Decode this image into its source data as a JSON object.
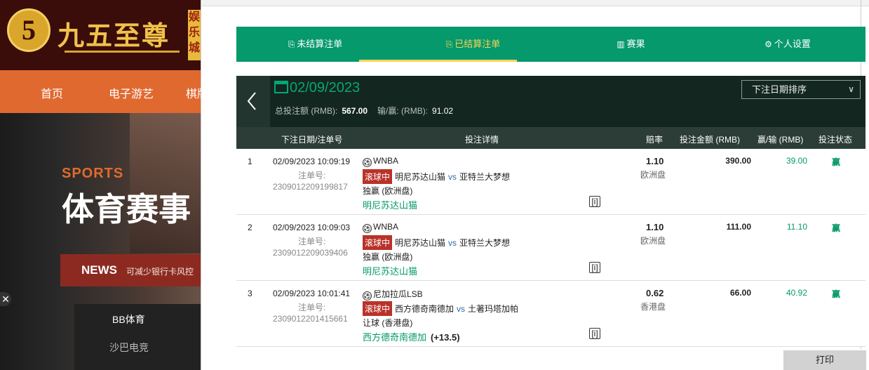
{
  "background_site": {
    "logo_glyph": "5",
    "logo_text": "九五至尊",
    "side_badge": "娱乐城",
    "nav": [
      "首页",
      "电子游艺",
      "棋牌"
    ],
    "sports_label": "SPORTS",
    "hero_title": "体育赛事",
    "news_label": "NEWS",
    "news_text": "可减少银行卡风控",
    "menu": [
      "BB体育",
      "沙巴电竞"
    ],
    "close_glyph": "✕"
  },
  "tabs": [
    {
      "icon": "⎘",
      "label": "未结算注单"
    },
    {
      "icon": "⎘",
      "label": "已结算注单"
    },
    {
      "icon": "▥",
      "label": "赛果"
    },
    {
      "icon": "⚙",
      "label": "个人设置"
    }
  ],
  "summary": {
    "date": "02/09/2023",
    "total_stake_label": "总投注额 (RMB):",
    "total_stake_value": "567.00",
    "winloss_label": "输/赢: (RMB):",
    "winloss_value": "91.02",
    "sort_label": "下注日期排序",
    "sort_chevron": "∨"
  },
  "columns": [
    "下注日期/注单号",
    "投注详情",
    "赔率",
    "投注金额 (RMB)",
    "赢/输 (RMB)",
    "投注状态"
  ],
  "rows": [
    {
      "index": "1",
      "time": "02/09/2023 10:09:19",
      "order_label": "注单号:",
      "order_no": "2309012209199817",
      "ball": "⚽",
      "league": "WNBA",
      "live": "滚球中",
      "home": "明尼苏达山猫",
      "vs": "vs",
      "away": "亚特兰大梦想",
      "market": "独赢 (欧洲盘)",
      "selection": "明尼苏达山猫",
      "handicap": "",
      "bet_icon": "[i]",
      "odds": "1.10",
      "odds_type": "欧洲盘",
      "stake": "390.00",
      "winloss": "39.00",
      "status": "赢"
    },
    {
      "index": "2",
      "time": "02/09/2023 10:09:03",
      "order_label": "注单号:",
      "order_no": "2309012209039406",
      "ball": "⚽",
      "league": "WNBA",
      "live": "滚球中",
      "home": "明尼苏达山猫",
      "vs": "vs",
      "away": "亚特兰大梦想",
      "market": "独赢 (欧洲盘)",
      "selection": "明尼苏达山猫",
      "handicap": "",
      "bet_icon": "[i]",
      "odds": "1.10",
      "odds_type": "欧洲盘",
      "stake": "111.00",
      "winloss": "11.10",
      "status": "赢"
    },
    {
      "index": "3",
      "time": "02/09/2023 10:01:41",
      "order_label": "注单号:",
      "order_no": "2309012201415661",
      "ball": "⚽",
      "league": "尼加拉瓜LSB",
      "live": "滚球中",
      "home": "西方德奇南德加",
      "vs": "vs",
      "away": "土著玛塔加帕",
      "market": "让球 (香港盘)",
      "selection": "西方德奇南德加",
      "handicap": "(+13.5)",
      "bet_icon": "[i]",
      "odds": "0.62",
      "odds_type": "香港盘",
      "stake": "66.00",
      "winloss": "40.92",
      "status": "赢"
    }
  ],
  "print_label": "打印",
  "colors": {
    "tab_green": "#05996b",
    "active_yellow": "#f8d458",
    "summary_dark": "#142620",
    "live_red": "#b93229",
    "win_green": "#05996b"
  }
}
